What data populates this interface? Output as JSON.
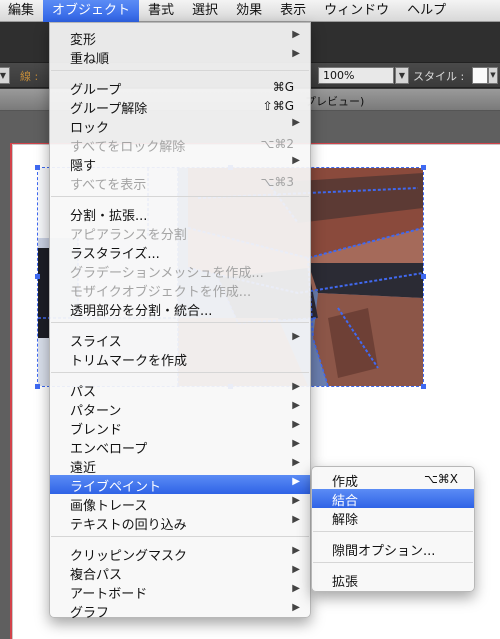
{
  "menubar": {
    "items": [
      "編集",
      "オブジェクト",
      "書式",
      "選択",
      "効果",
      "表示",
      "ウィンドウ",
      "ヘルプ"
    ]
  },
  "controlbar": {
    "stroke_label": "線 :",
    "opacity_value": "100%",
    "style_label": "スタイル :"
  },
  "document_tab": {
    "title_fragment": "プレビュー)"
  },
  "object_menu": {
    "items": [
      {
        "label": "変形",
        "shortcut": "",
        "submenu": true,
        "disabled": false
      },
      {
        "label": "重ね順",
        "shortcut": "",
        "submenu": true,
        "disabled": false
      },
      {
        "label": "グループ",
        "shortcut": "⌘G",
        "submenu": false,
        "disabled": false
      },
      {
        "label": "グループ解除",
        "shortcut": "⇧⌘G",
        "submenu": false,
        "disabled": false
      },
      {
        "label": "ロック",
        "shortcut": "",
        "submenu": true,
        "disabled": false
      },
      {
        "label": "すべてをロック解除",
        "shortcut": "⌥⌘2",
        "submenu": false,
        "disabled": true
      },
      {
        "label": "隠す",
        "shortcut": "",
        "submenu": true,
        "disabled": false
      },
      {
        "label": "すべてを表示",
        "shortcut": "⌥⌘3",
        "submenu": false,
        "disabled": true
      },
      {
        "label": "分割・拡張...",
        "shortcut": "",
        "submenu": false,
        "disabled": false
      },
      {
        "label": "アピアランスを分割",
        "shortcut": "",
        "submenu": false,
        "disabled": true
      },
      {
        "label": "ラスタライズ...",
        "shortcut": "",
        "submenu": false,
        "disabled": false
      },
      {
        "label": "グラデーションメッシュを作成...",
        "shortcut": "",
        "submenu": false,
        "disabled": true
      },
      {
        "label": "モザイクオブジェクトを作成...",
        "shortcut": "",
        "submenu": false,
        "disabled": true
      },
      {
        "label": "透明部分を分割・統合...",
        "shortcut": "",
        "submenu": false,
        "disabled": false
      },
      {
        "label": "スライス",
        "shortcut": "",
        "submenu": true,
        "disabled": false
      },
      {
        "label": "トリムマークを作成",
        "shortcut": "",
        "submenu": false,
        "disabled": false
      },
      {
        "label": "パス",
        "shortcut": "",
        "submenu": true,
        "disabled": false
      },
      {
        "label": "パターン",
        "shortcut": "",
        "submenu": true,
        "disabled": false
      },
      {
        "label": "ブレンド",
        "shortcut": "",
        "submenu": true,
        "disabled": false
      },
      {
        "label": "エンベロープ",
        "shortcut": "",
        "submenu": true,
        "disabled": false
      },
      {
        "label": "遠近",
        "shortcut": "",
        "submenu": true,
        "disabled": false
      },
      {
        "label": "ライブペイント",
        "shortcut": "",
        "submenu": true,
        "disabled": false
      },
      {
        "label": "画像トレース",
        "shortcut": "",
        "submenu": true,
        "disabled": false
      },
      {
        "label": "テキストの回り込み",
        "shortcut": "",
        "submenu": true,
        "disabled": false
      },
      {
        "label": "クリッピングマスク",
        "shortcut": "",
        "submenu": true,
        "disabled": false
      },
      {
        "label": "複合パス",
        "shortcut": "",
        "submenu": true,
        "disabled": false
      },
      {
        "label": "アートボード",
        "shortcut": "",
        "submenu": true,
        "disabled": false
      },
      {
        "label": "グラフ",
        "shortcut": "",
        "submenu": true,
        "disabled": false
      }
    ]
  },
  "livepaint_submenu": {
    "items": [
      {
        "label": "作成",
        "shortcut": "⌥⌘X"
      },
      {
        "label": "結合",
        "shortcut": ""
      },
      {
        "label": "解除",
        "shortcut": ""
      },
      {
        "label": "隙間オプション...",
        "shortcut": ""
      },
      {
        "label": "拡張",
        "shortcut": ""
      }
    ]
  },
  "colors": {
    "highlight": "#3b6ff0",
    "selection": "#3f6af2",
    "artboard_edge": "#d2424a"
  },
  "icons": [
    "submenu-arrow-icon",
    "dropdown-arrow-icon"
  ]
}
